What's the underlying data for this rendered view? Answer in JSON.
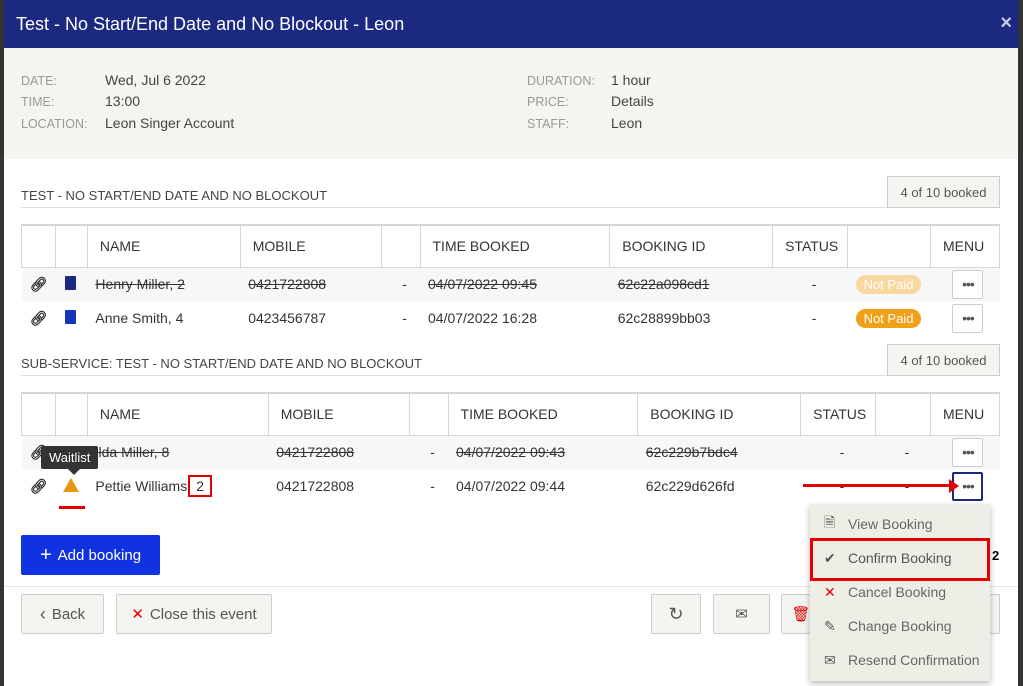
{
  "modal": {
    "title": "Test - No Start/End Date and No Blockout - Leon",
    "close_icon": "×"
  },
  "info": {
    "date_label": "DATE:",
    "date_value": "Wed, Jul 6 2022",
    "time_label": "TIME:",
    "time_value": "13:00",
    "location_label": "LOCATION:",
    "location_value": "Leon Singer Account",
    "duration_label": "DURATION:",
    "duration_value": "1 hour",
    "price_label": "PRICE:",
    "price_value": "Details",
    "staff_label": "STAFF:",
    "staff_value": "Leon"
  },
  "section1": {
    "title": "TEST - NO START/END DATE AND NO BLOCKOUT",
    "booked": "4 of 10 booked",
    "headers": [
      "NAME",
      "MOBILE",
      "TIME BOOKED",
      "BOOKING ID",
      "STATUS",
      "MENU"
    ],
    "rows": [
      {
        "name": "Henry Miller, 2",
        "mobile": "0421722808",
        "dash": "-",
        "time": "04/07/2022 09:45",
        "id": "62c22a098cd1",
        "status": "-",
        "pill": "Not Paid"
      },
      {
        "name": "Anne Smith, 4",
        "mobile": "0423456787",
        "dash": "-",
        "time": "04/07/2022 16:28",
        "id": "62c28899bb03",
        "status": "-",
        "pill": "Not Paid"
      }
    ]
  },
  "section2": {
    "title": "SUB-SERVICE: TEST - NO START/END DATE AND NO BLOCKOUT",
    "booked": "4 of 10 booked",
    "headers": [
      "NAME",
      "MOBILE",
      "TIME BOOKED",
      "BOOKING ID",
      "STATUS",
      "MENU"
    ],
    "rows": [
      {
        "name": "ilda Miller, 8",
        "mobile": "0421722808",
        "dash": "-",
        "time": "04/07/2022 09:43",
        "id": "62c229b7bdc4",
        "status": "-",
        "extra": "-"
      },
      {
        "name": "Pettie Williams",
        "mobile": "0421722808",
        "dash": "-",
        "time": "04/07/2022 09:44",
        "id": "62c229d626fd",
        "status": "-",
        "extra": "-"
      }
    ],
    "count_annotation": "2"
  },
  "tooltip": "Waitlist",
  "add_booking": "Add booking",
  "footer": {
    "back": "Back",
    "close_event": "Close this event"
  },
  "dropdown": {
    "items": [
      "View Booking",
      "Confirm Booking",
      "Cancel Booking",
      "Change Booking",
      "Resend Confirmation"
    ]
  },
  "annotation_step": "2"
}
